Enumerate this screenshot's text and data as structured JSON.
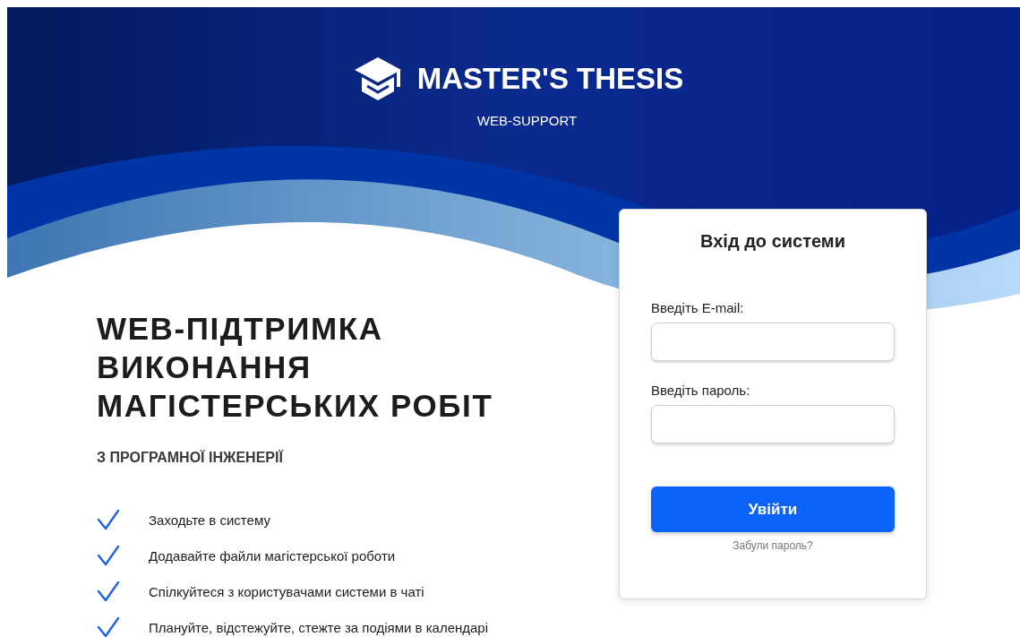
{
  "header": {
    "title": "MASTER'S THESIS",
    "subtitle": "WEB-SUPPORT"
  },
  "hero": {
    "heading_lines": [
      "WEB-ПІДТРИМКА",
      "ВИКОНАННЯ",
      "МАГІСТЕРСЬКИХ РОБІТ"
    ],
    "subheading": "З ПРОГРАМНОЇ ІНЖЕНЕРІЇ",
    "features": [
      "Заходьте в систему",
      "Додавайте файли магістерської роботи",
      "Спілкуйтеся з користувачами системи в чаті",
      "Плануйте, відстежуйте, стежте за подіями в календарі"
    ]
  },
  "login": {
    "title": "Вхід до системи",
    "fields": [
      {
        "label": "Введіть E-mail:"
      },
      {
        "label": "Введіть пароль:"
      }
    ],
    "submit": "Увійти",
    "forgot_link": "Забули пароль?"
  }
}
